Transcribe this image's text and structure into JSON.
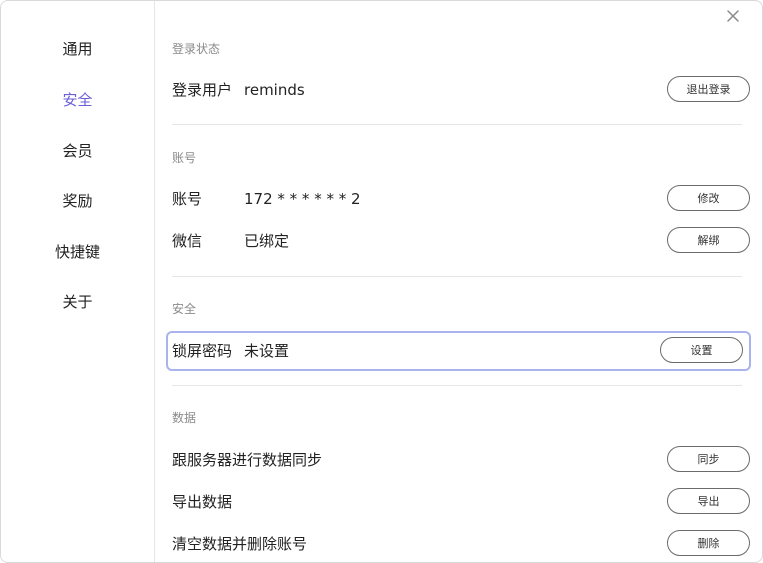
{
  "sidebar": {
    "items": [
      {
        "label": "通用"
      },
      {
        "label": "安全"
      },
      {
        "label": "会员"
      },
      {
        "label": "奖励"
      },
      {
        "label": "快捷键"
      },
      {
        "label": "关于"
      }
    ],
    "active_index": 1
  },
  "window": {
    "close_icon": "close-icon"
  },
  "sections": {
    "login": {
      "title": "登录状态",
      "user_label": "登录用户",
      "user_value": "reminds",
      "logout_button": "退出登录"
    },
    "account": {
      "title": "账号",
      "account_label": "账号",
      "account_value": "172 * * * * * * 2",
      "account_button": "修改",
      "wechat_label": "微信",
      "wechat_value": "已绑定",
      "wechat_button": "解绑"
    },
    "security": {
      "title": "安全",
      "lock_label": "锁屏密码",
      "lock_value": "未设置",
      "lock_button": "设置"
    },
    "data": {
      "title": "数据",
      "sync_label": "跟服务器进行数据同步",
      "sync_button": "同步",
      "export_label": "导出数据",
      "export_button": "导出",
      "delete_label": "清空数据并删除账号",
      "delete_button": "删除"
    }
  },
  "colors": {
    "accent": "#6a5fd6",
    "focus_border": "#a9b3ee",
    "muted_text": "#8a8a8a",
    "divider": "#e6e6e6"
  }
}
